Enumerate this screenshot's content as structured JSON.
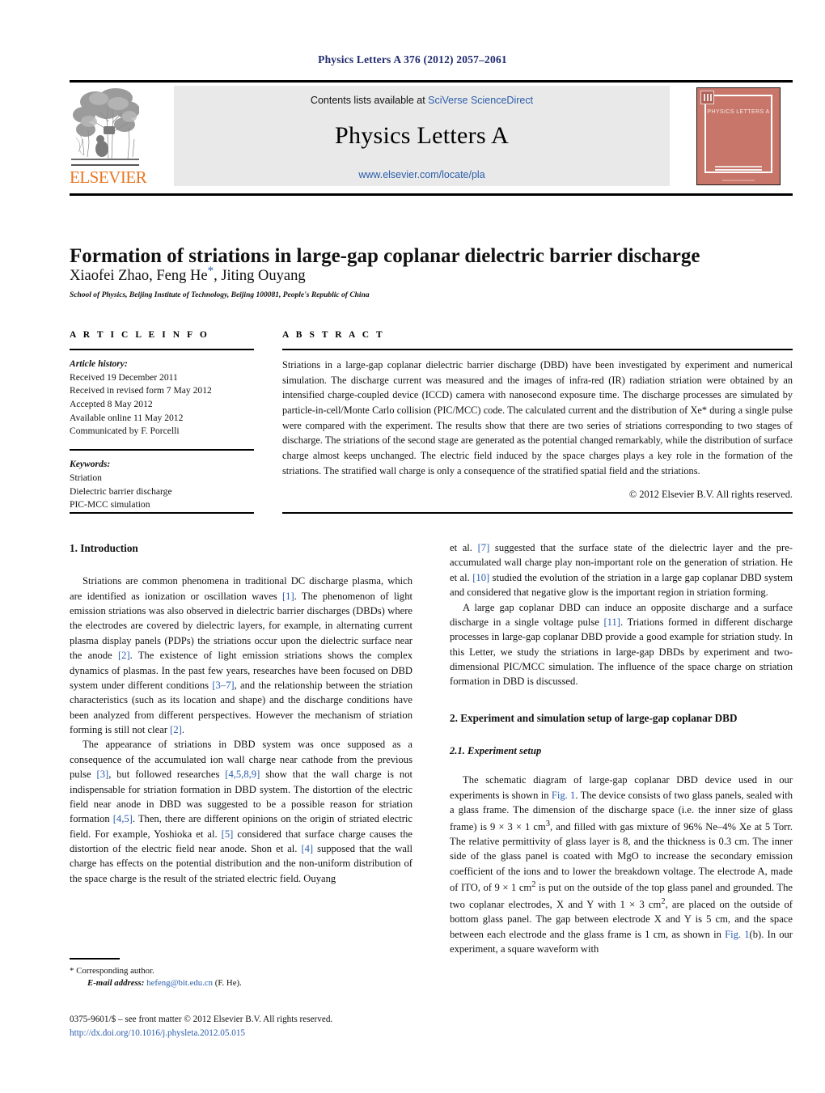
{
  "running_head": "Physics Letters A 376 (2012) 2057–2061",
  "masthead": {
    "contents_prefix": "Contents lists available at ",
    "sciencedirect_link": "SciVerse ScienceDirect",
    "journal_title": "Physics Letters A",
    "journal_url": "www.elsevier.com/locate/pla",
    "publisher_wordmark": "ELSEVIER",
    "cover_title": "PHYSICS LETTERS A",
    "accent_color": "#2a5caa",
    "band_color": "#e9e9e9",
    "cover_color": "#c8766a",
    "wordmark_color": "#E87722"
  },
  "title": "Formation of striations in large-gap coplanar dielectric barrier discharge",
  "authors_pre": "Xiaofei Zhao, Feng He",
  "authors_star": "*",
  "authors_post": ", Jiting Ouyang",
  "affiliation": "School of Physics, Beijing Institute of Technology, Beijing 100081, People's Republic of China",
  "article_info": {
    "heading": "A R T I C L E    I N F O",
    "history_label": "Article history:",
    "history": [
      "Received 19 December 2011",
      "Received in revised form 7 May 2012",
      "Accepted 8 May 2012",
      "Available online 11 May 2012",
      "Communicated by F. Porcelli"
    ],
    "keywords_label": "Keywords:",
    "keywords": [
      "Striation",
      "Dielectric barrier discharge",
      "PIC-MCC simulation"
    ]
  },
  "abstract": {
    "heading": "A B S T R A C T",
    "text": "Striations in a large-gap coplanar dielectric barrier discharge (DBD) have been investigated by experiment and numerical simulation. The discharge current was measured and the images of infra-red (IR) radiation striation were obtained by an intensified charge-coupled device (ICCD) camera with nanosecond exposure time. The discharge processes are simulated by particle-in-cell/Monte Carlo collision (PIC/MCC) code. The calculated current and the distribution of Xe* during a single pulse were compared with the experiment. The results show that there are two series of striations corresponding to two stages of discharge. The striations of the second stage are generated as the potential changed remarkably, while the distribution of surface charge almost keeps unchanged. The electric field induced by the space charges plays a key role in the formation of the striations. The stratified wall charge is only a consequence of the stratified spatial field and the striations.",
    "copyright": "© 2012 Elsevier B.V. All rights reserved."
  },
  "body": {
    "intro_heading": "1. Introduction",
    "p1_a": "Striations are common phenomena in traditional DC discharge plasma, which are identified as ionization or oscillation waves ",
    "p1_r1": "[1]",
    "p1_b": ". The phenomenon of light emission striations was also observed in dielectric barrier discharges (DBDs) where the electrodes are covered by dielectric layers, for example, in alternating current plasma display panels (PDPs) the striations occur upon the dielectric surface near the anode ",
    "p1_r2": "[2]",
    "p1_c": ". The existence of light emission striations shows the complex dynamics of plasmas. In the past few years, researches have been focused on DBD system under different conditions ",
    "p1_r3": "[3–7]",
    "p1_d": ", and the relationship between the striation characteristics (such as its location and shape) and the discharge conditions have been analyzed from different perspectives. However the mechanism of striation forming is still not clear ",
    "p1_r4": "[2]",
    "p1_e": ".",
    "p2_a": "The appearance of striations in DBD system was once supposed as a consequence of the accumulated ion wall charge near cathode from the previous pulse ",
    "p2_r1": "[3]",
    "p2_b": ", but followed researches ",
    "p2_r2": "[4,5,8,9]",
    "p2_c": " show that the wall charge is not indispensable for striation formation in DBD system. The distortion of the electric field near anode in DBD was suggested to be a possible reason for striation formation ",
    "p2_r3": "[4,5]",
    "p2_d": ". Then, there are different opinions on the origin of striated electric field. For example, Yoshioka et al. ",
    "p2_r4": "[5]",
    "p2_e": " considered that surface charge causes the distortion of the electric field near anode. Shon et al. ",
    "p2_r5": "[4]",
    "p2_f": " supposed that the wall charge has effects on the potential distribution and the non-uniform distribution of the space charge is the result of the striated electric field. Ouyang",
    "p3_a": "et al. ",
    "p3_r1": "[7]",
    "p3_b": " suggested that the surface state of the dielectric layer and the pre-accumulated wall charge play non-important role on the generation of striation. He et al. ",
    "p3_r2": "[10]",
    "p3_c": " studied the evolution of the striation in a large gap coplanar DBD system and considered that negative glow is the important region in striation forming.",
    "p4_a": "A large gap coplanar DBD can induce an opposite discharge and a surface discharge in a single voltage pulse ",
    "p4_r1": "[11]",
    "p4_b": ". Triations formed in different discharge processes in large-gap coplanar DBD provide a good example for striation study. In this Letter, we study the striations in large-gap DBDs by experiment and two-dimensional PIC/MCC simulation. The influence of the space charge on striation formation in DBD is discussed.",
    "sec2_heading": "2. Experiment and simulation setup of large-gap coplanar DBD",
    "sec21_heading": "2.1. Experiment setup",
    "p5_a": "The schematic diagram of large-gap coplanar DBD device used in our experiments is shown in ",
    "p5_r1": "Fig. 1",
    "p5_b": ". The device consists of two glass panels, sealed with a glass frame. The dimension of the discharge space (i.e. the inner size of glass frame) is 9 × 3 × 1 cm",
    "p5_sup1": "3",
    "p5_c": ", and filled with gas mixture of 96% Ne–4% Xe at 5 Torr. The relative permittivity of glass layer is 8, and the thickness is 0.3 cm. The inner side of the glass panel is coated with MgO to increase the secondary emission coefficient of the ions and to lower the breakdown voltage. The electrode A, made of ITO, of 9 × 1 cm",
    "p5_sup2": "2",
    "p5_d": " is put on the outside of the top glass panel and grounded. The two coplanar electrodes, X and Y with 1 × 3 cm",
    "p5_sup3": "2",
    "p5_e": ", are placed on the outside of bottom glass panel. The gap between electrode X and Y is 5 cm, and the space between each electrode and the glass frame is 1 cm, as shown in ",
    "p5_r2": "Fig. 1",
    "p5_f": "(b). In our experiment, a square waveform with"
  },
  "footnote": {
    "star": "*",
    "corresponding": " Corresponding author.",
    "email_label": "E-mail address:",
    "email": "hefeng@bit.edu.cn",
    "email_suffix": " (F. He).",
    "issn_line": "0375-9601/$ – see front matter  © 2012 Elsevier B.V. All rights reserved.",
    "doi": "http://dx.doi.org/10.1016/j.physleta.2012.05.015"
  }
}
